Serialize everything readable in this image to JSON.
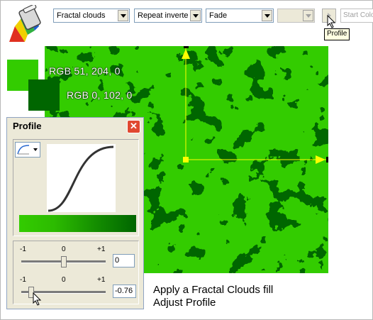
{
  "toolbar": {
    "fill_type": "Fractal clouds",
    "tiling": "Repeat inverte",
    "effect": "Fade",
    "blank_select": "",
    "start_color": "Start Colo",
    "tooltip": "Profile"
  },
  "swatches": {
    "start": {
      "label": "RGB 51, 204, 0",
      "color": "#33cc00"
    },
    "end": {
      "label": "RGB 0, 102, 0",
      "color": "#006600"
    }
  },
  "canvas": {
    "fill_color_a": "#33cc00",
    "fill_color_b": "#006600",
    "handle_color": "#ffff00"
  },
  "caption": {
    "line1": "Apply a Fractal Clouds fill",
    "line2": "Adjust Profile"
  },
  "profile_dialog": {
    "title": "Profile",
    "close_glyph": "✕",
    "slider1": {
      "min_label": "-1",
      "mid_label": "0",
      "max_label": "+1",
      "value": "0",
      "position": 0.5
    },
    "slider2": {
      "min_label": "-1",
      "mid_label": "0",
      "max_label": "+1",
      "value": "-0.76",
      "position": 0.12
    }
  },
  "icons": [
    "fill-tool-icon",
    "profile-preset-icon",
    "mouse-cursor-icon",
    "close-icon"
  ]
}
